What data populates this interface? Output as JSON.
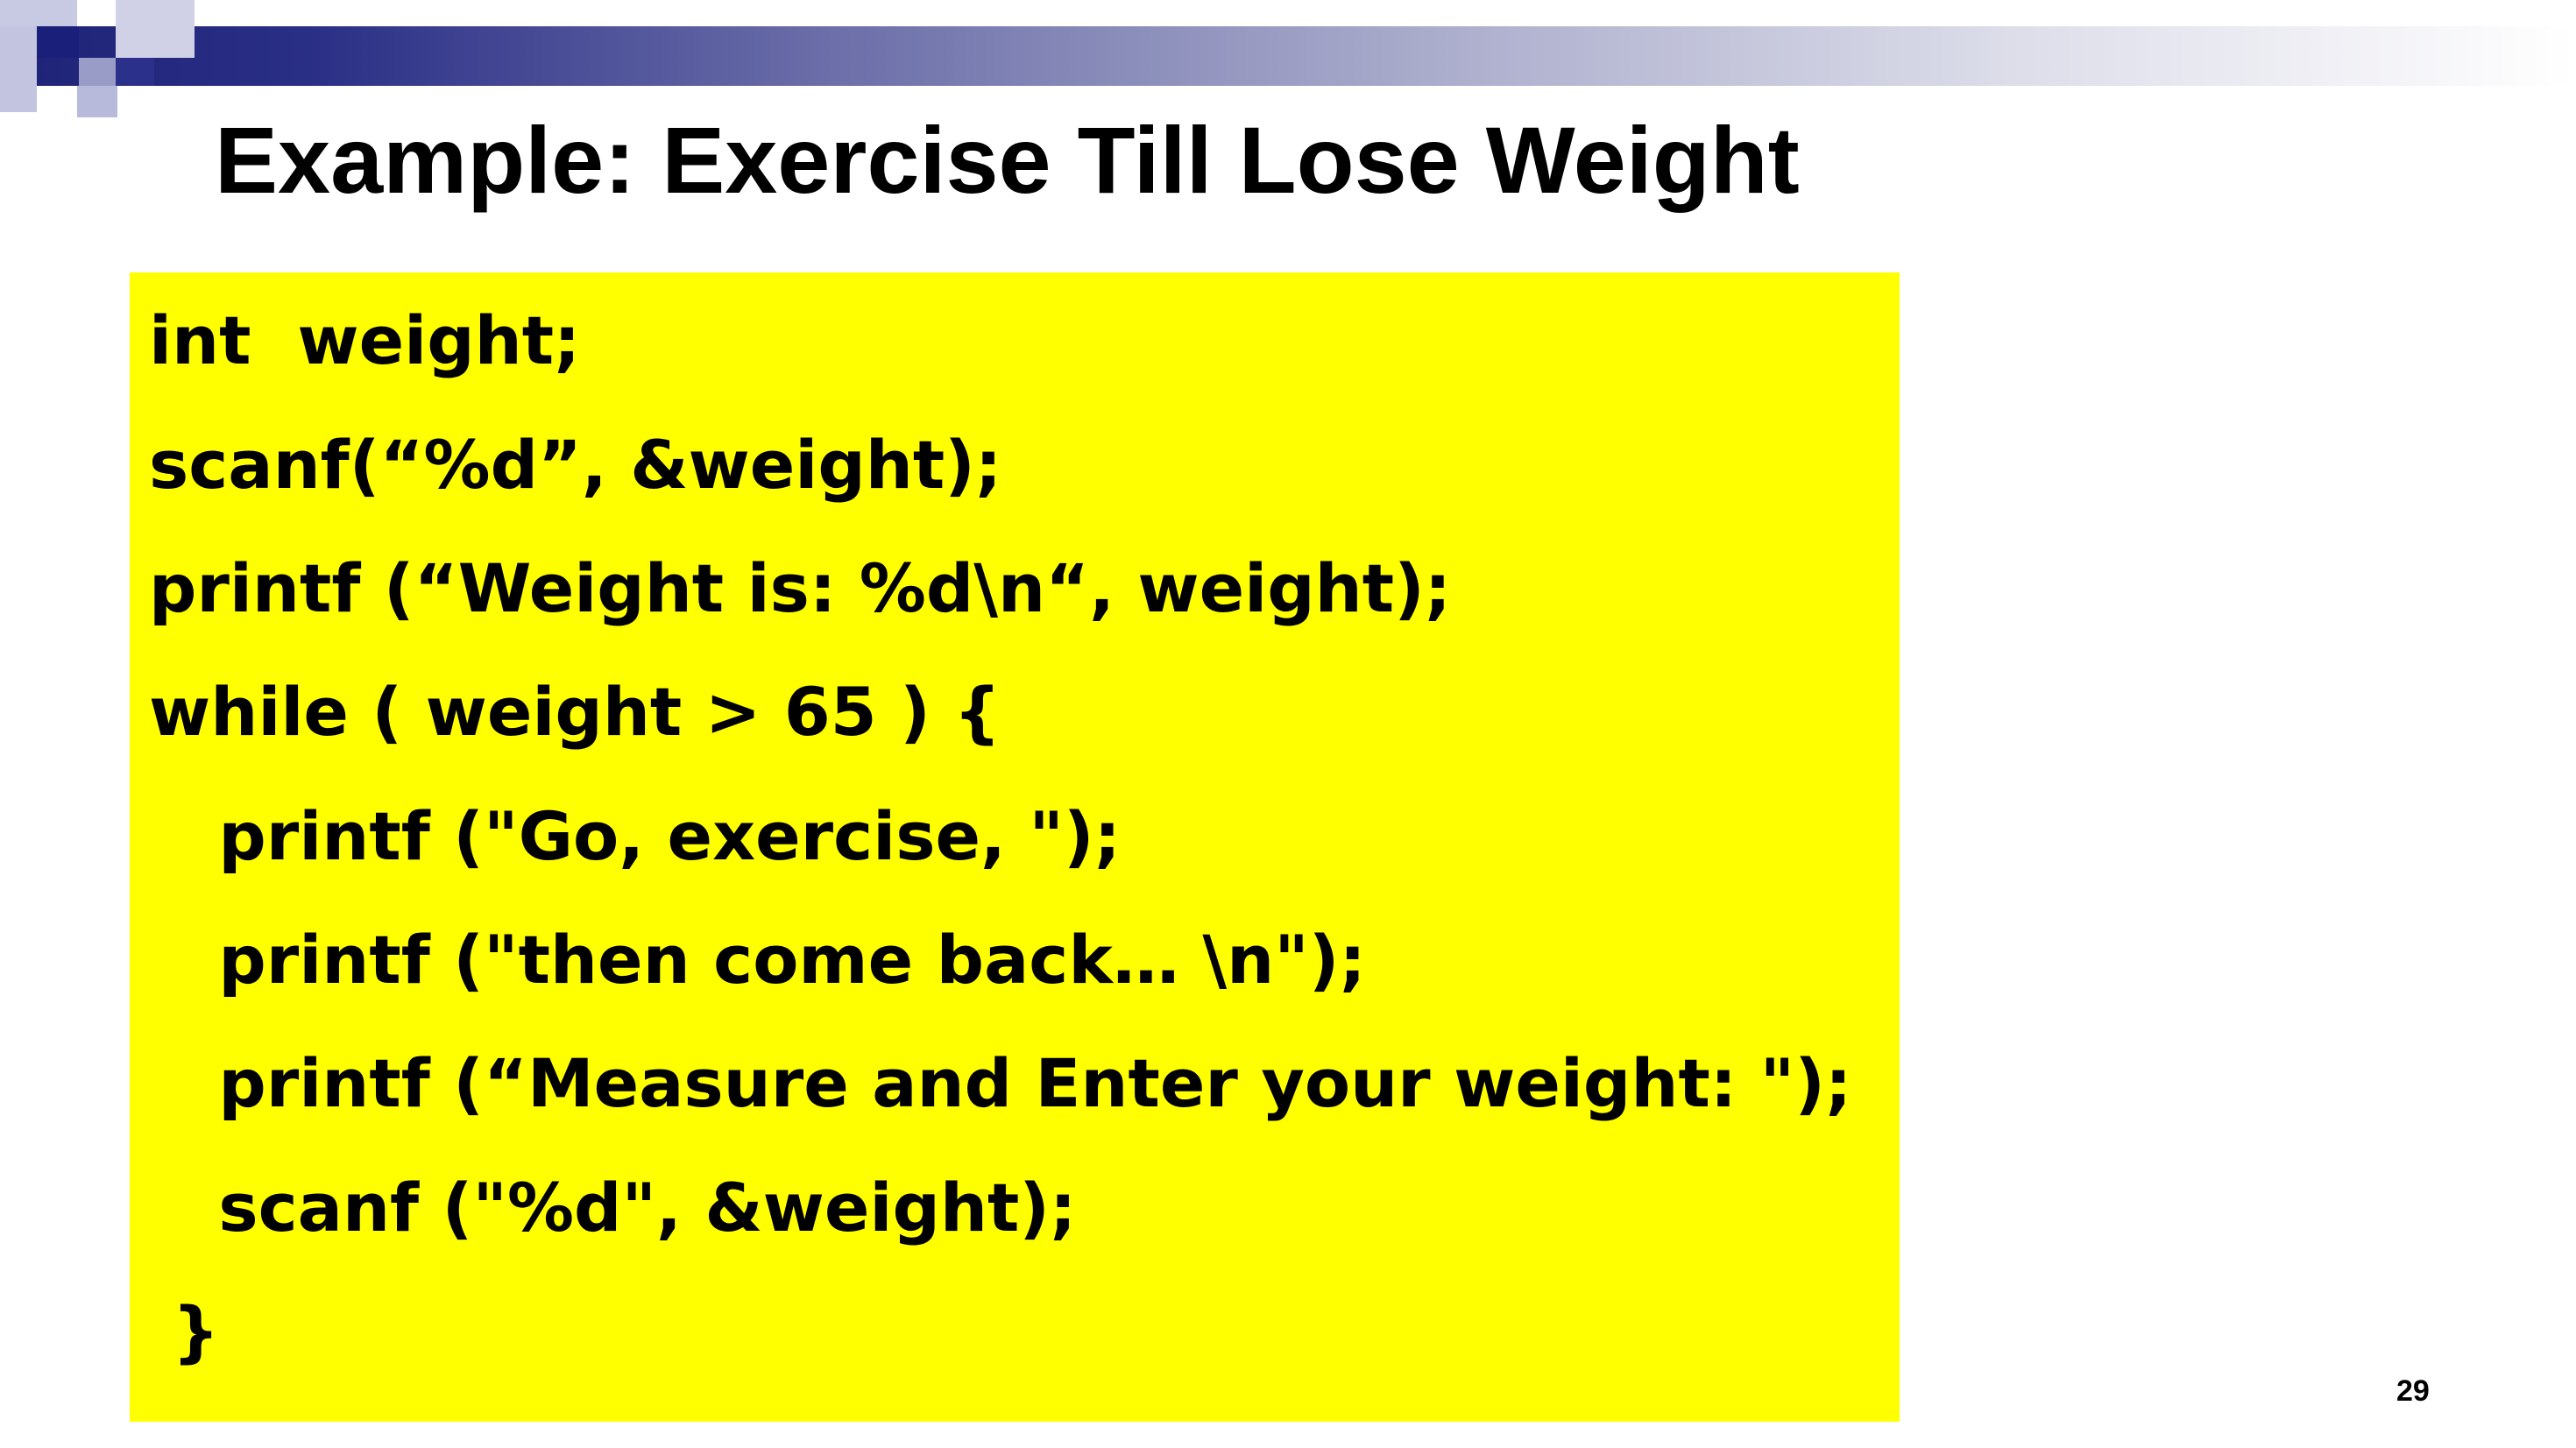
{
  "slide": {
    "title": "Example: Exercise Till Lose Weight",
    "page_number": "29",
    "colors": {
      "code_background": "#ffff00",
      "accent_navy": "#1a1f7a",
      "text": "#000000"
    }
  },
  "code": {
    "lines": [
      "int  weight;",
      "scanf(“%d”, &weight);",
      "printf (“Weight is: %d\\n“, weight);",
      "while ( weight > 65 ) {",
      "   printf (\"Go, exercise, \");",
      "   printf (\"then come back… \\n\");",
      "   printf (“Measure and Enter your weight: \");",
      "   scanf (\"%d\", &weight);",
      " }"
    ]
  }
}
